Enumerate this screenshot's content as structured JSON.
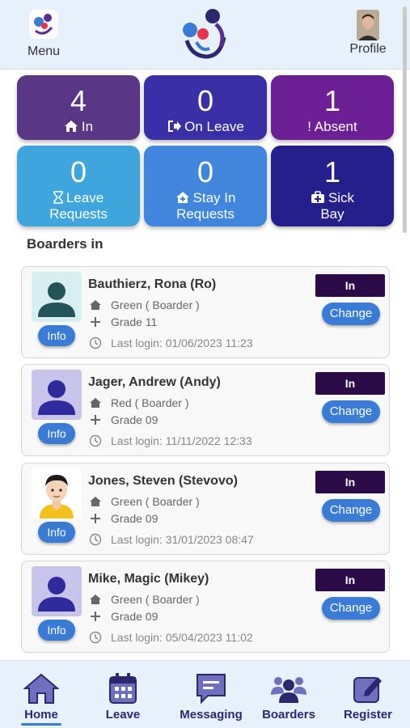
{
  "header": {
    "menu_label": "Menu",
    "profile_label": "Profile",
    "logo_icon": "boarding-app-logo"
  },
  "stats": [
    {
      "number": "4",
      "label": "In",
      "icon": "home-icon",
      "color": "#5b3687"
    },
    {
      "number": "0",
      "label": "On Leave",
      "icon": "sign-out-icon",
      "color": "#3b2fa8"
    },
    {
      "number": "1",
      "label": "! Absent",
      "icon": "",
      "color": "#6c1f94"
    },
    {
      "number": "0",
      "label": "Leave",
      "label2": "Requests",
      "icon": "hourglass-icon",
      "color": "#3ea5dd"
    },
    {
      "number": "0",
      "label": "Stay In",
      "label2": "Requests",
      "icon": "home-stay-icon",
      "color": "#3f86dc"
    },
    {
      "number": "1",
      "label": "Sick",
      "label2": "Bay",
      "icon": "medkit-icon",
      "color": "#241f8a"
    }
  ],
  "section_title": "Boarders in",
  "boarders": [
    {
      "name": "Bauthierz, Rona (Ro)",
      "house": "Green ( Boarder )",
      "grade": "Grade 11",
      "last_login": "Last login: 01/06/2023 11:23",
      "status": "In",
      "change_label": "Change",
      "info_label": "Info",
      "avatar": "default-avatar-teal"
    },
    {
      "name": "Jager, Andrew (Andy)",
      "house": "Red ( Boarder )",
      "grade": "Grade 09",
      "last_login": "Last login: 11/11/2022 12:33",
      "status": "In",
      "change_label": "Change",
      "info_label": "Info",
      "avatar": "default-avatar-purple"
    },
    {
      "name": "Jones, Steven (Stevovo)",
      "house": "Green ( Boarder )",
      "grade": "Grade 09",
      "last_login": "Last login: 31/01/2023 08:47",
      "status": "In",
      "change_label": "Change",
      "info_label": "Info",
      "avatar": "cartoon-avatar"
    },
    {
      "name": "Mike, Magic (Mikey)",
      "house": "Green ( Boarder )",
      "grade": "Grade 09",
      "last_login": "Last login: 05/04/2023 11:02",
      "status": "In",
      "change_label": "Change",
      "info_label": "Info",
      "avatar": "default-avatar-purple"
    }
  ],
  "nav": [
    {
      "label": "Home",
      "icon": "home-icon",
      "active": true
    },
    {
      "label": "Leave",
      "icon": "calendar-icon",
      "active": false
    },
    {
      "label": "Messaging",
      "icon": "message-icon",
      "active": false
    },
    {
      "label": "Boarders",
      "icon": "users-icon",
      "active": false
    },
    {
      "label": "Register",
      "icon": "edit-icon",
      "active": false
    }
  ]
}
